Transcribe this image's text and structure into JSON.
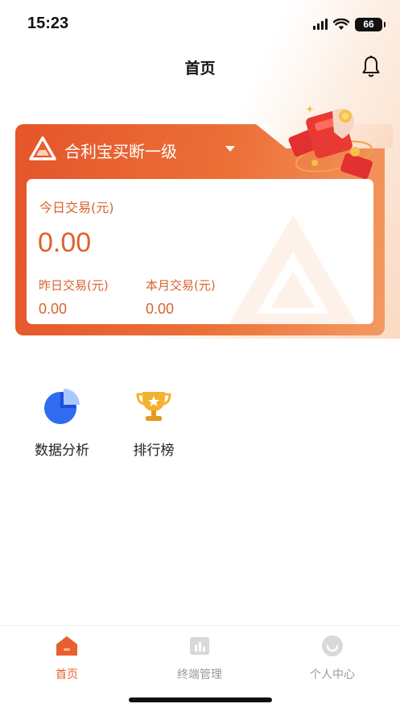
{
  "status_bar": {
    "time": "15:23",
    "battery": "66"
  },
  "nav": {
    "title": "首页"
  },
  "card": {
    "title": "合利宝买断一级",
    "today_label": "今日交易(元)",
    "today_value": "0.00",
    "yesterday_label": "昨日交易(元)",
    "yesterday_value": "0.00",
    "month_label": "本月交易(元)",
    "month_value": "0.00"
  },
  "quick_actions": [
    {
      "label": "数据分析",
      "icon": "pie-chart-icon"
    },
    {
      "label": "排行榜",
      "icon": "trophy-icon"
    }
  ],
  "tabs": [
    {
      "label": "首页",
      "icon": "home-icon",
      "active": true
    },
    {
      "label": "终端管理",
      "icon": "bar-chart-icon",
      "active": false
    },
    {
      "label": "个人中心",
      "icon": "profile-icon",
      "active": false
    }
  ],
  "colors": {
    "accent": "#e8602b",
    "inactive": "#999999"
  }
}
